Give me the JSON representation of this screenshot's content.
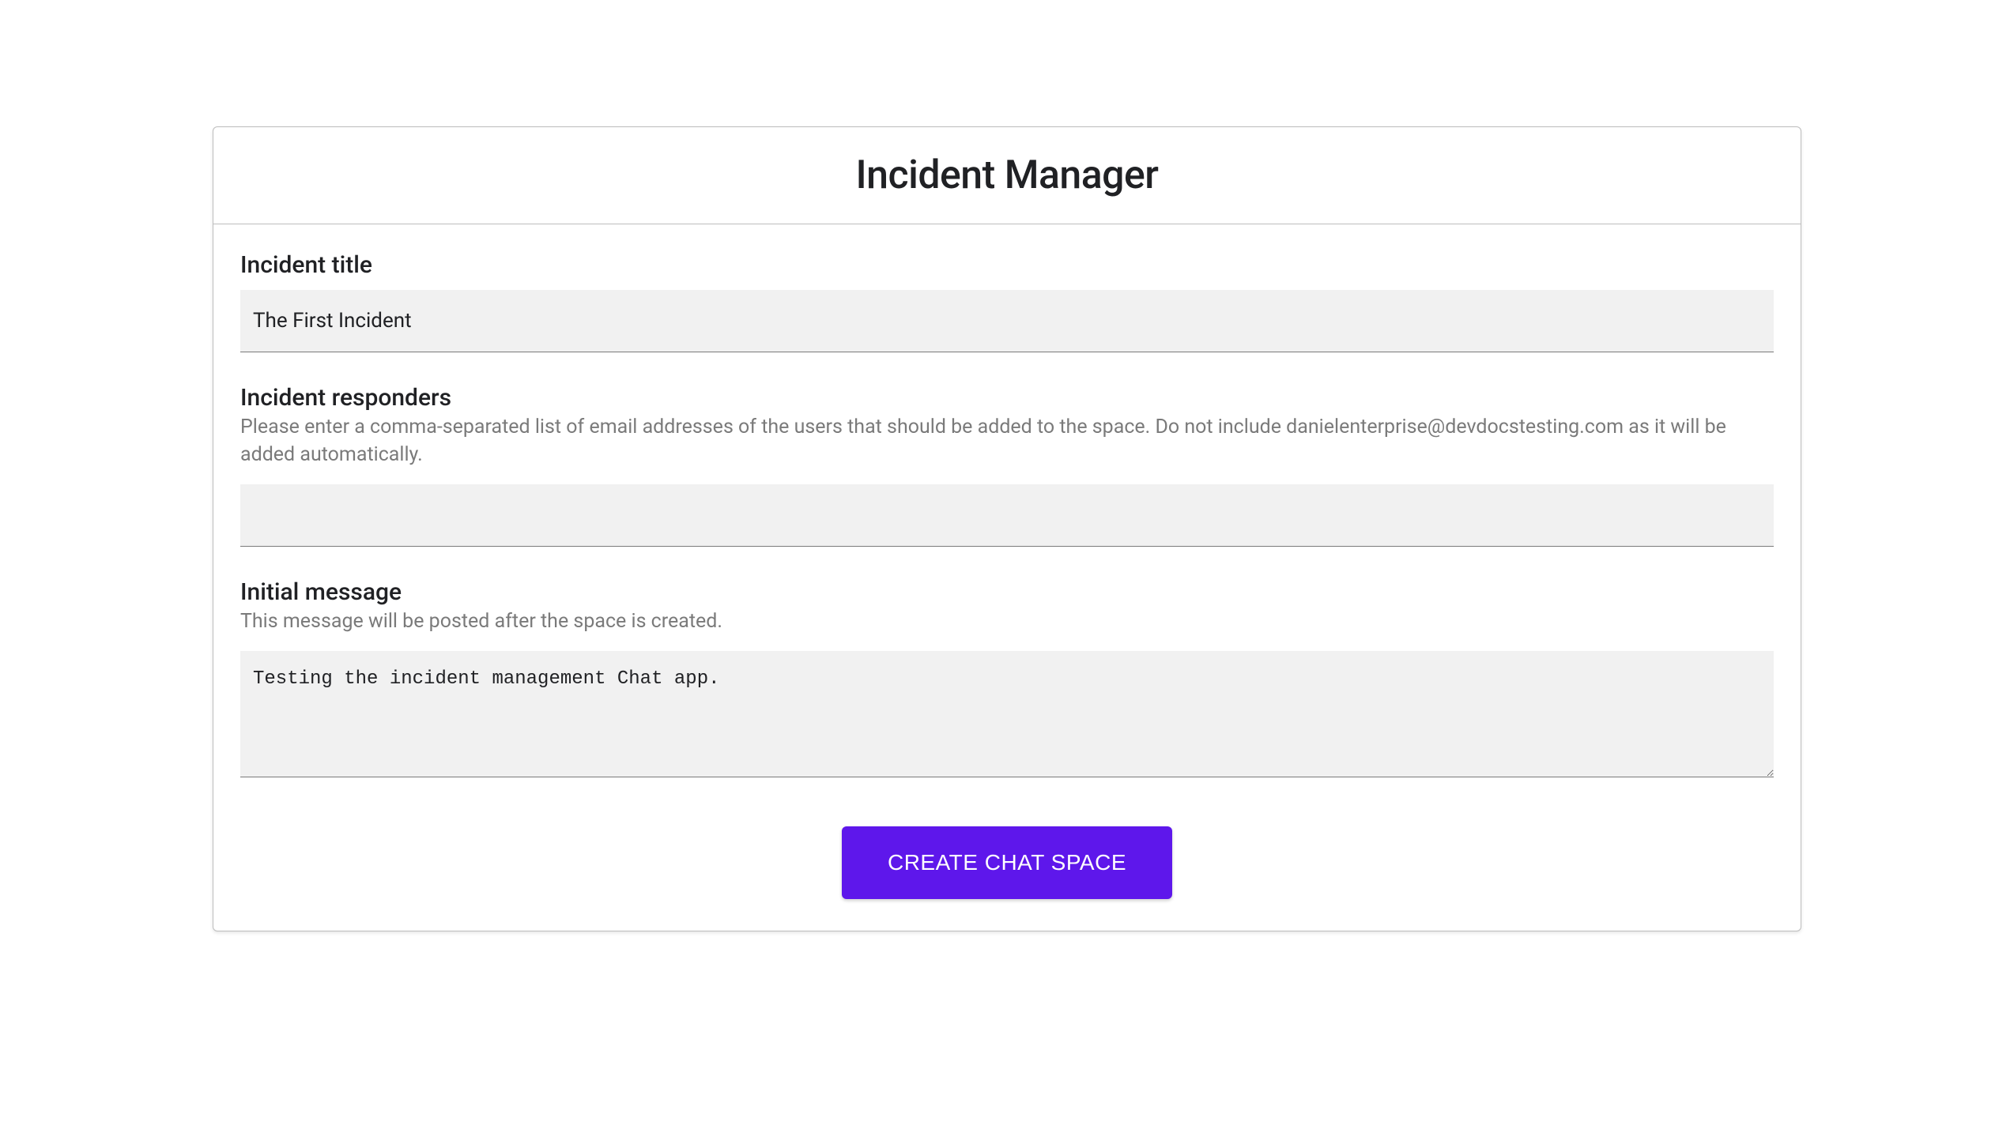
{
  "header": {
    "title": "Incident Manager"
  },
  "form": {
    "incident_title": {
      "label": "Incident title",
      "value": "The First Incident"
    },
    "incident_responders": {
      "label": "Incident responders",
      "helper": "Please enter a comma-separated list of email addresses of the users that should be added to the space. Do not include danielenterprise@devdocstesting.com as it will be added automatically.",
      "value": ""
    },
    "initial_message": {
      "label": "Initial message",
      "helper": "This message will be posted after the space is created.",
      "value": "Testing the incident management Chat app."
    }
  },
  "actions": {
    "create_button_label": "CREATE CHAT SPACE"
  }
}
